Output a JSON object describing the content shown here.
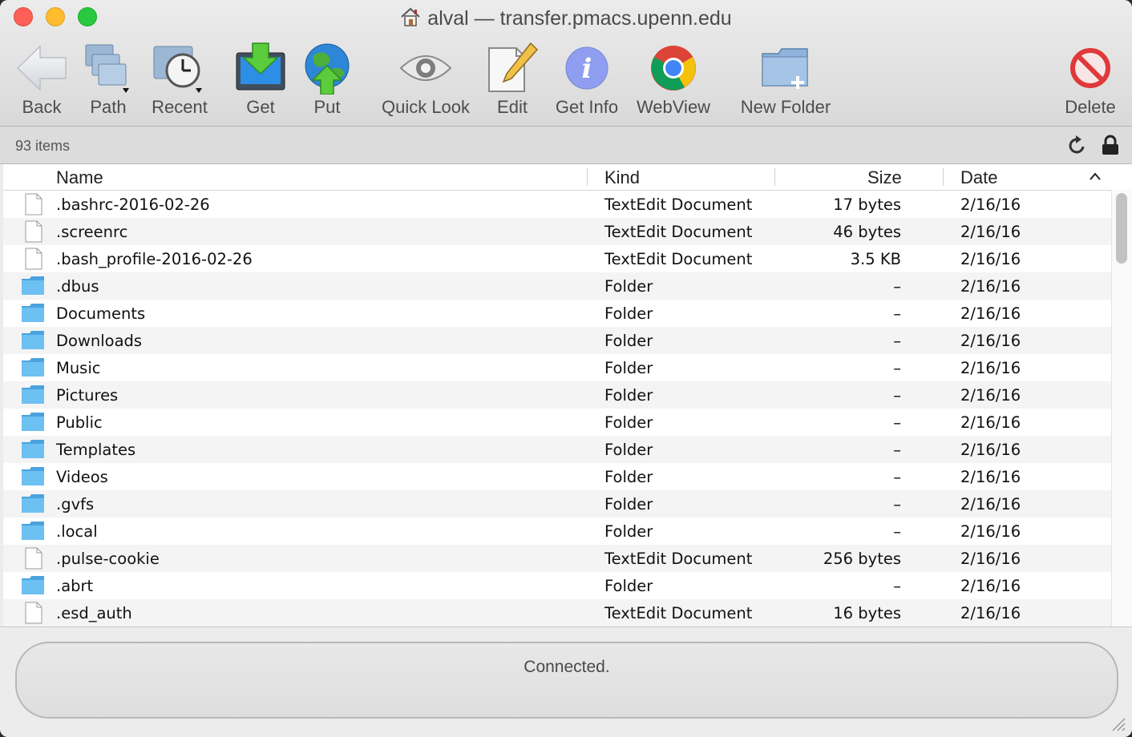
{
  "window": {
    "title": "alval — transfer.pmacs.upenn.edu"
  },
  "toolbar": {
    "back": "Back",
    "path": "Path",
    "recent": "Recent",
    "get": "Get",
    "put": "Put",
    "quick_look": "Quick Look",
    "edit": "Edit",
    "get_info": "Get Info",
    "webview": "WebView",
    "new_folder": "New Folder",
    "delete": "Delete"
  },
  "status": {
    "item_count": "93 items",
    "connection": "Connected."
  },
  "columns": {
    "name": "Name",
    "kind": "Kind",
    "size": "Size",
    "date": "Date"
  },
  "files": [
    {
      "icon": "document-icon",
      "name": ".bashrc-2016-02-26",
      "kind": "TextEdit Document",
      "size": "17 bytes",
      "date": "2/16/16"
    },
    {
      "icon": "document-icon",
      "name": ".screenrc",
      "kind": "TextEdit Document",
      "size": "46 bytes",
      "date": "2/16/16"
    },
    {
      "icon": "document-icon",
      "name": ".bash_profile-2016-02-26",
      "kind": "TextEdit Document",
      "size": "3.5 KB",
      "date": "2/16/16"
    },
    {
      "icon": "folder-icon",
      "name": ".dbus",
      "kind": "Folder",
      "size": "–",
      "date": "2/16/16"
    },
    {
      "icon": "folder-icon",
      "name": "Documents",
      "kind": "Folder",
      "size": "–",
      "date": "2/16/16"
    },
    {
      "icon": "folder-icon",
      "name": "Downloads",
      "kind": "Folder",
      "size": "–",
      "date": "2/16/16"
    },
    {
      "icon": "folder-icon",
      "name": "Music",
      "kind": "Folder",
      "size": "–",
      "date": "2/16/16"
    },
    {
      "icon": "folder-icon",
      "name": "Pictures",
      "kind": "Folder",
      "size": "–",
      "date": "2/16/16"
    },
    {
      "icon": "folder-icon",
      "name": "Public",
      "kind": "Folder",
      "size": "–",
      "date": "2/16/16"
    },
    {
      "icon": "folder-icon",
      "name": "Templates",
      "kind": "Folder",
      "size": "–",
      "date": "2/16/16"
    },
    {
      "icon": "folder-icon",
      "name": "Videos",
      "kind": "Folder",
      "size": "–",
      "date": "2/16/16"
    },
    {
      "icon": "folder-icon",
      "name": ".gvfs",
      "kind": "Folder",
      "size": "–",
      "date": "2/16/16"
    },
    {
      "icon": "folder-icon",
      "name": ".local",
      "kind": "Folder",
      "size": "–",
      "date": "2/16/16"
    },
    {
      "icon": "document-icon",
      "name": ".pulse-cookie",
      "kind": "TextEdit Document",
      "size": "256 bytes",
      "date": "2/16/16"
    },
    {
      "icon": "folder-icon",
      "name": ".abrt",
      "kind": "Folder",
      "size": "–",
      "date": "2/16/16"
    },
    {
      "icon": "document-icon",
      "name": ".esd_auth",
      "kind": "TextEdit Document",
      "size": "16 bytes",
      "date": "2/16/16"
    }
  ],
  "colors": {
    "folder": "#5ab3ea",
    "delete": "#e0393a",
    "info": "#8f9ef0"
  }
}
